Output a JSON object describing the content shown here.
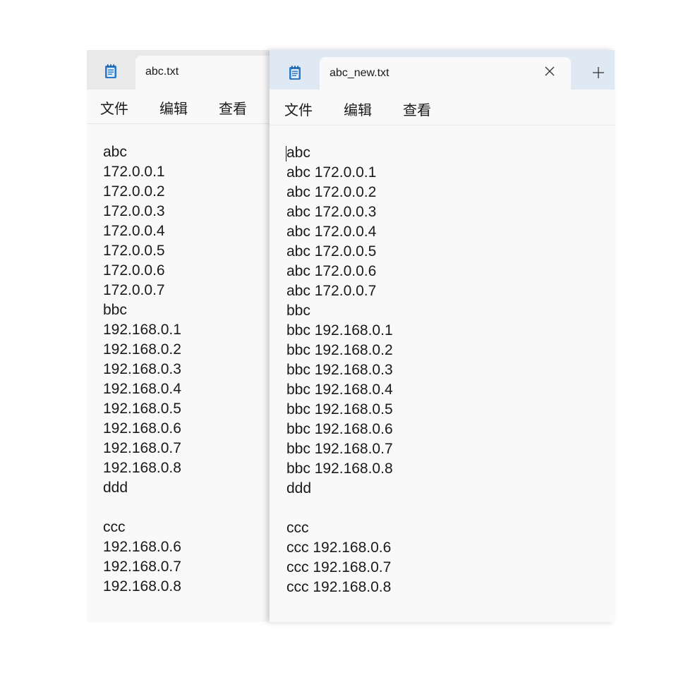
{
  "left_window": {
    "tab_title": "abc.txt",
    "menu": {
      "file": "文件",
      "edit": "编辑",
      "view": "查看"
    },
    "lines": [
      "abc",
      "172.0.0.1",
      "172.0.0.2",
      "172.0.0.3",
      "172.0.0.4",
      "172.0.0.5",
      "172.0.0.6",
      "172.0.0.7",
      "bbc",
      "192.168.0.1",
      "192.168.0.2",
      "192.168.0.3",
      "192.168.0.4",
      "192.168.0.5",
      "192.168.0.6",
      "192.168.0.7",
      "192.168.0.8",
      "ddd",
      "",
      "ccc",
      "192.168.0.6",
      "192.168.0.7",
      "192.168.0.8"
    ]
  },
  "right_window": {
    "tab_title": "abc_new.txt",
    "menu": {
      "file": "文件",
      "edit": "编辑",
      "view": "查看"
    },
    "lines": [
      "abc",
      "abc 172.0.0.1",
      "abc 172.0.0.2",
      "abc 172.0.0.3",
      "abc 172.0.0.4",
      "abc 172.0.0.5",
      "abc 172.0.0.6",
      "abc 172.0.0.7",
      "bbc",
      "bbc 192.168.0.1",
      "bbc 192.168.0.2",
      "bbc 192.168.0.3",
      "bbc 192.168.0.4",
      "bbc 192.168.0.5",
      "bbc 192.168.0.6",
      "bbc 192.168.0.7",
      "bbc 192.168.0.8",
      "ddd",
      "",
      "ccc",
      "ccc 192.168.0.6",
      "ccc 192.168.0.7",
      "ccc 192.168.0.8"
    ]
  },
  "icons": {
    "app": "notepad-icon",
    "close": "close-icon",
    "new_tab": "plus-icon"
  },
  "colors": {
    "editor_bg": "#f9f9f9",
    "inactive_tabbar": "#e9e9e9",
    "active_tabbar": "#dfe9f3",
    "notepad_icon": "#2b78c5"
  }
}
